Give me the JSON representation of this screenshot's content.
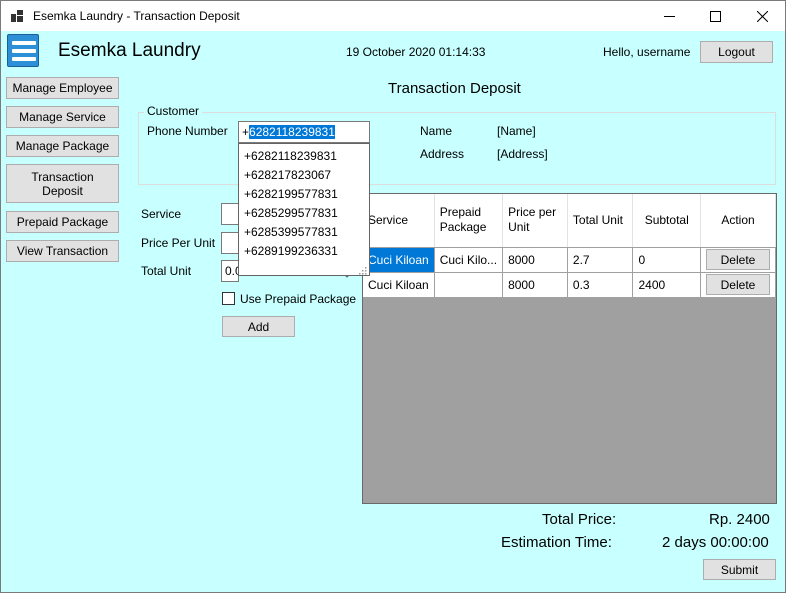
{
  "window": {
    "title": "Esemka Laundry - Transaction Deposit"
  },
  "header": {
    "app_name": "Esemka Laundry",
    "datetime": "19 October 2020 01:14:33",
    "greeting": "Hello, username",
    "logout_label": "Logout"
  },
  "nav": {
    "manage_employee": "Manage Employee",
    "manage_service": "Manage Service",
    "manage_package": "Manage Package",
    "transaction_deposit": "Transaction Deposit",
    "prepaid_package": "Prepaid Package",
    "view_transaction": "View Transaction"
  },
  "page": {
    "heading": "Transaction Deposit"
  },
  "customer": {
    "group_title": "Customer",
    "phone_label": "Phone Number",
    "phone_prefix": "+",
    "phone_selected": "6282118239831",
    "suggestions": [
      "+6282118239831",
      "+628217823067",
      "+6282199577831",
      "+6285299577831",
      "+6285399577831",
      "+6289199236331"
    ],
    "name_label": "Name",
    "name_value": "[Name]",
    "address_label": "Address",
    "address_value": "[Address]"
  },
  "form": {
    "service_label": "Service",
    "price_label": "Price Per Unit",
    "total_unit_label": "Total Unit",
    "total_unit_value": "0.0",
    "prepaid_checkbox_label": "Use Prepaid Package",
    "add_label": "Add"
  },
  "grid": {
    "headers": {
      "service": "Service",
      "prepaid_package": "Prepaid Package",
      "price_per_unit": "Price per Unit",
      "total_unit": "Total Unit",
      "subtotal": "Subtotal",
      "action": "Action"
    },
    "rows": [
      {
        "service": "Cuci Kiloan",
        "prepaid_package": "Cuci Kilo...",
        "price": "8000",
        "total_unit": "2.7",
        "subtotal": "0",
        "action": "Delete"
      },
      {
        "service": "Cuci Kiloan",
        "prepaid_package": "",
        "price": "8000",
        "total_unit": "0.3",
        "subtotal": "2400",
        "action": "Delete"
      }
    ]
  },
  "summary": {
    "total_price_label": "Total Price:",
    "total_price_value": "Rp. 2400",
    "estimation_label": "Estimation Time:",
    "estimation_value": "2 days 00:00:00",
    "submit_label": "Submit"
  }
}
